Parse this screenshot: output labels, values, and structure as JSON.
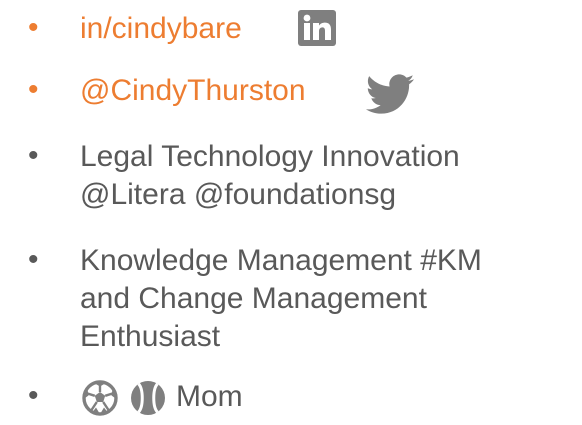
{
  "colors": {
    "accent": "#ED7D31",
    "text": "#595959",
    "icon": "#7F7F7F"
  },
  "bullets": {
    "symbol": "•"
  },
  "linkedin": {
    "handle": "in/cindybare",
    "icon": "linkedin-icon"
  },
  "twitter": {
    "handle": "@CindyThurston",
    "icon": "twitter-bird-icon"
  },
  "legal_tech": {
    "line1": "Legal Technology Innovation",
    "line2": "@Litera @foundationsg"
  },
  "knowledge": {
    "line1": "Knowledge Management #KM",
    "line2": "and Change Management",
    "line3": "Enthusiast"
  },
  "mom": {
    "icons": [
      "soccer-ball-icon",
      "baseball-icon"
    ],
    "label": "Mom"
  }
}
